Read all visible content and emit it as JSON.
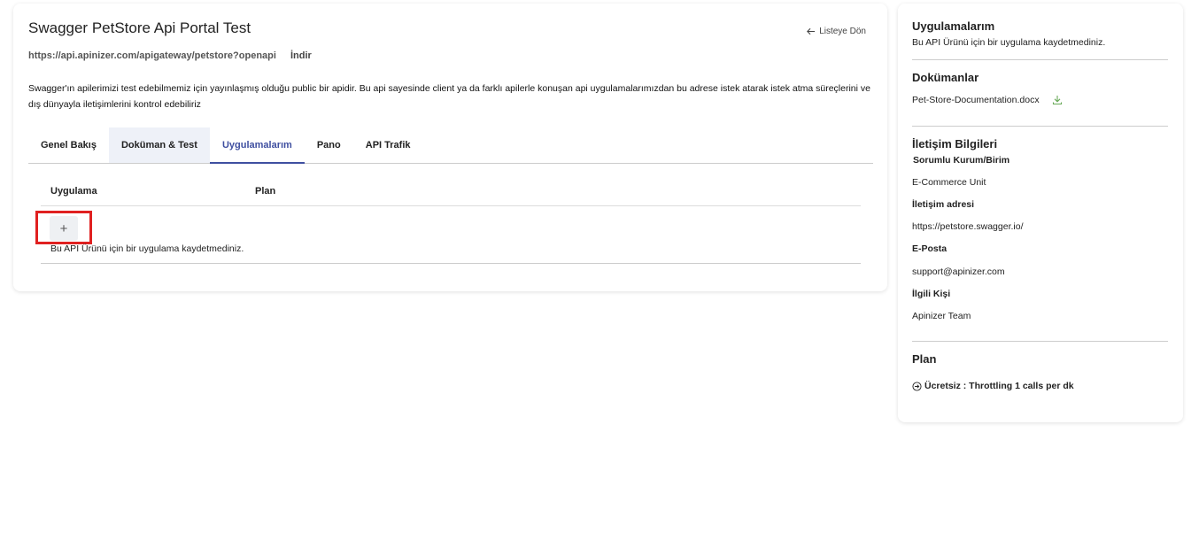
{
  "header": {
    "title": "Swagger PetStore Api Portal Test",
    "back_label": "Listeye Dön",
    "url": "https://api.apinizer.com/apigateway/petstore?openapi",
    "download_label": "İndir"
  },
  "description": "Swagger'ın apilerimizi test edebilmemiz için yayınlaşmış olduğu public bir apidir. Bu api sayesinde client ya da farklı apilerle konuşan api uygulamalarımızdan bu adrese istek atarak istek atma süreçlerini ve dış dünyayla iletişimlerini kontrol edebiliriz",
  "tabs": [
    {
      "label": "Genel Bakış"
    },
    {
      "label": "Doküman & Test"
    },
    {
      "label": "Uygulamalarım"
    },
    {
      "label": "Pano"
    },
    {
      "label": "API Trafik"
    }
  ],
  "table": {
    "columns": [
      "Uygulama",
      "Plan"
    ],
    "add_label": "+",
    "empty_message": "Bu API Ürünü için bir uygulama kaydetmediniz."
  },
  "sidebar": {
    "apps_title": "Uygulamalarım",
    "apps_empty": "Bu API Ürünü için bir uygulama kaydetmediniz.",
    "docs_title": "Dokümanlar",
    "doc_file": "Pet-Store-Documentation.docx",
    "contact_title": "İletişim Bilgileri",
    "org_label": "Sorumlu Kurum/Birim",
    "org_value": "E-Commerce Unit",
    "address_label": "İletişim adresi",
    "address_value": "https://petstore.swagger.io/",
    "email_label": "E-Posta",
    "email_value": "support@apinizer.com",
    "person_label": "İlgili Kişi",
    "person_value": "Apinizer Team",
    "plan_title": "Plan",
    "plan_item": "Ücretsiz : Throttling 1 calls per dk"
  },
  "colors": {
    "accent": "#3f4fa0",
    "highlight": "#e02020",
    "download_icon": "#6aaa5a"
  }
}
